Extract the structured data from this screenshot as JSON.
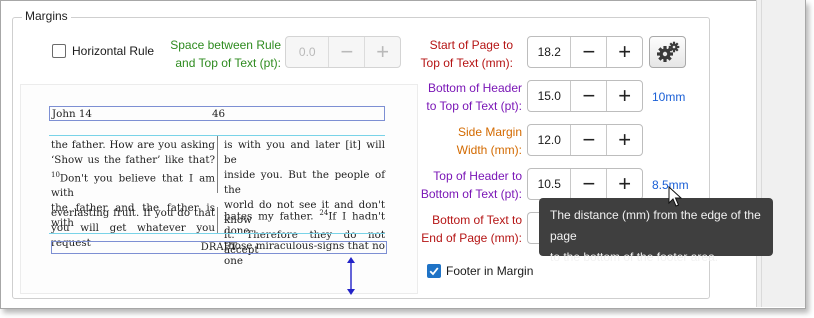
{
  "group": {
    "title": "Margins"
  },
  "horizontal_rule": {
    "label": "Horizontal Rule",
    "checked": false
  },
  "space_between": {
    "label_line1": "Space between Rule",
    "label_line2": "and Top of Text (pt):",
    "value": "0.0",
    "minus": "−",
    "plus": "+",
    "color": "#2e8b1f",
    "enabled": false
  },
  "start_of_page": {
    "label_line1": "Start of Page to",
    "label_line2": "Top of Text (mm):",
    "value": "18.2",
    "minus": "−",
    "plus": "+",
    "color": "#b51414"
  },
  "bottom_header": {
    "label_line1": "Bottom of Header",
    "label_line2": "to Top of Text (pt):",
    "value": "15.0",
    "minus": "−",
    "plus": "+",
    "color": "#7a16b6",
    "hint": "10mm"
  },
  "side_margin": {
    "label_line1": "Side Margin",
    "label_line2": "Width (mm):",
    "value": "12.0",
    "minus": "−",
    "plus": "+",
    "color": "#d36a00"
  },
  "top_header": {
    "label_line1": "Top of Header to",
    "label_line2": "Bottom of Text (pt):",
    "value": "10.5",
    "minus": "−",
    "plus": "+",
    "color": "#7a16b6",
    "hint": "8.5mm"
  },
  "bottom_text": {
    "label_line1": "Bottom of Text to",
    "label_line2": "End of Page (mm):",
    "color": "#b51414"
  },
  "footer_in_margin": {
    "label": "Footer in Margin",
    "checked": true
  },
  "settings_button": {
    "icon": "gear-icon"
  },
  "hint_color": "#1a5fd6",
  "tooltip": {
    "line1": "The distance (mm) from the edge of the page",
    "line2": "to the bottom of the footer area."
  },
  "preview": {
    "header_left": "John 14",
    "header_page": "46",
    "left_col_1": [
      "the father. How are you asking",
      "‘Show us the father’ like that?",
      "Don't you believe that I am with",
      "the father and the father is with"
    ],
    "verse_10": "10",
    "right_col_1": [
      "is with you and later [it] will be",
      "inside you. But the people of the",
      "world do not see it and don't know",
      "it. Therefore they do not accept"
    ],
    "left_col_2": [
      "everlasting fruit. If you do that",
      "you will get whatever you request"
    ],
    "right_col_2_line1_prefix": "hates my father.",
    "verse_24": "24",
    "right_col_2_line1_suffix": "If I hadn't done",
    "right_col_2_line2": "those miraculous-signs that no one",
    "footer": "DRAFT"
  }
}
